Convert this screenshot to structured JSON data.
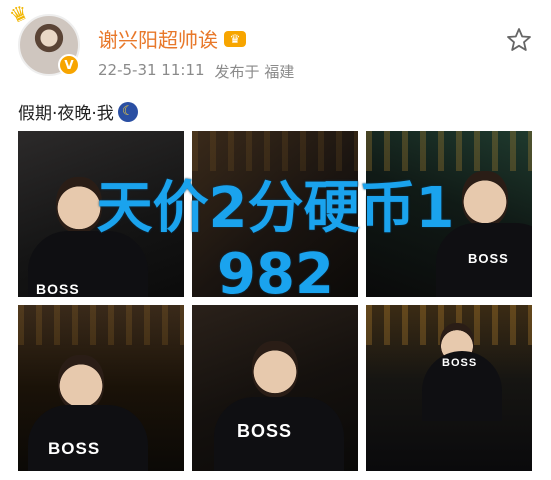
{
  "user": {
    "name": "谢兴阳超帅诶",
    "timestamp": "22-5-31 11:11",
    "source": "发布于 福建"
  },
  "post": {
    "text": "假期·夜晚·我"
  },
  "photos": [
    {
      "shirt": "BOSS"
    },
    {
      "shirt": ""
    },
    {
      "shirt": "BOSS"
    },
    {
      "shirt": "BOSS"
    },
    {
      "shirt": "BOSS"
    },
    {
      "shirt": "BOSS"
    }
  ],
  "overlay": {
    "line1": "天价2分硬币1",
    "line2": "982"
  },
  "colors": {
    "name": "#e8782a",
    "meta": "#8a8a8a",
    "overlay": "#1aa3ee",
    "verify": "#f7a500"
  },
  "icons": [
    "crown-icon",
    "verified-icon",
    "vip-crown-icon",
    "star-icon",
    "moon-icon"
  ]
}
